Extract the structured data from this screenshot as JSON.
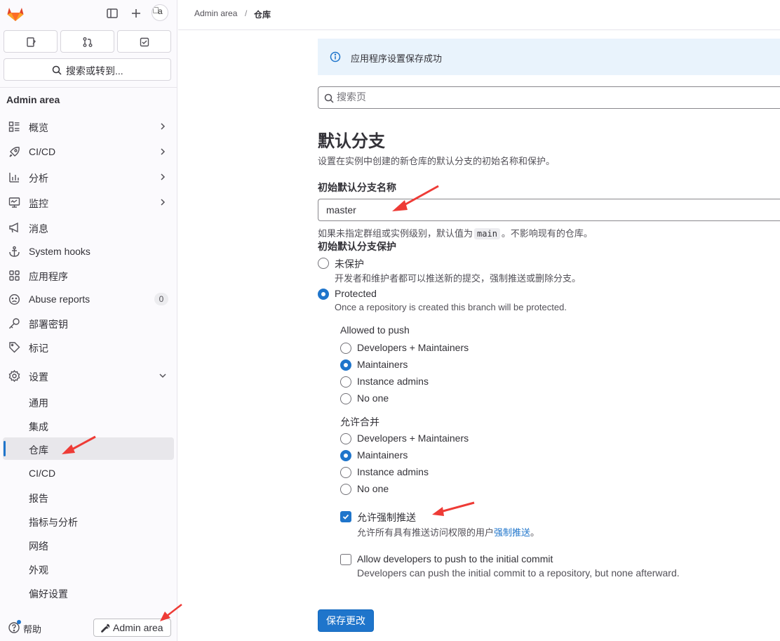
{
  "sidebar": {
    "search_label": "搜索或转到...",
    "avatar_alt": "a",
    "heading": "Admin area",
    "items": [
      {
        "label": "概览",
        "icon": "overview-icon"
      },
      {
        "label": "CI/CD",
        "icon": "rocket-icon"
      },
      {
        "label": "分析",
        "icon": "chart-icon"
      },
      {
        "label": "监控",
        "icon": "monitor-icon"
      },
      {
        "label": "消息",
        "icon": "megaphone-icon"
      },
      {
        "label": "System hooks",
        "icon": "anchor-icon"
      },
      {
        "label": "应用程序",
        "icon": "applications-icon"
      },
      {
        "label": "Abuse reports",
        "icon": "abuse-icon",
        "badge": "0"
      },
      {
        "label": "部署密钥",
        "icon": "key-icon"
      },
      {
        "label": "标记",
        "icon": "label-icon"
      },
      {
        "label": "设置",
        "icon": "settings-icon"
      }
    ],
    "settings_sub": [
      "通用",
      "集成",
      "仓库",
      "CI/CD",
      "报告",
      "指标与分析",
      "网络",
      "外观",
      "偏好设置"
    ],
    "help_label": "帮助",
    "admin_btn_label": "Admin area"
  },
  "breadcrumb": {
    "first": "Admin area",
    "sep": "/",
    "current": "仓库"
  },
  "alert": {
    "text": "应用程序设置保存成功"
  },
  "page_search": {
    "placeholder": "搜索页"
  },
  "section": {
    "title": "默认分支",
    "description": "设置在实例中创建的新仓库的默认分支的初始名称和保护。",
    "name_label": "初始默认分支名称",
    "name_value": "master",
    "name_help_pre": "如果未指定群组或实例级别，默认值为",
    "name_help_code": "main",
    "name_help_post": "。不影响现有的仓库。",
    "protection_label": "初始默认分支保护",
    "unprotected_label": "未保护",
    "unprotected_help": "开发者和维护者都可以推送新的提交，强制推送或删除分支。",
    "protected_label": "Protected",
    "protected_help": "Once a repository is created this branch will be protected.",
    "push_label": "Allowed to push",
    "push_options": [
      "Developers + Maintainers",
      "Maintainers",
      "Instance admins",
      "No one"
    ],
    "merge_label": "允许合并",
    "merge_options": [
      "Developers + Maintainers",
      "Maintainers",
      "Instance admins",
      "No one"
    ],
    "force_push_label": "允许强制推送",
    "force_push_help_pre": "允许所有具有推送访问权限的用户",
    "force_push_help_link": "强制推送",
    "force_push_help_post": "。",
    "initial_commit_label": "Allow developers to push to the initial commit",
    "initial_commit_help": "Developers can push the initial commit to a repository, but none afterward."
  },
  "save_label": "保存更改",
  "colors": {
    "accent": "#1f75cb",
    "annotation_arrow": "#ee3b36"
  }
}
